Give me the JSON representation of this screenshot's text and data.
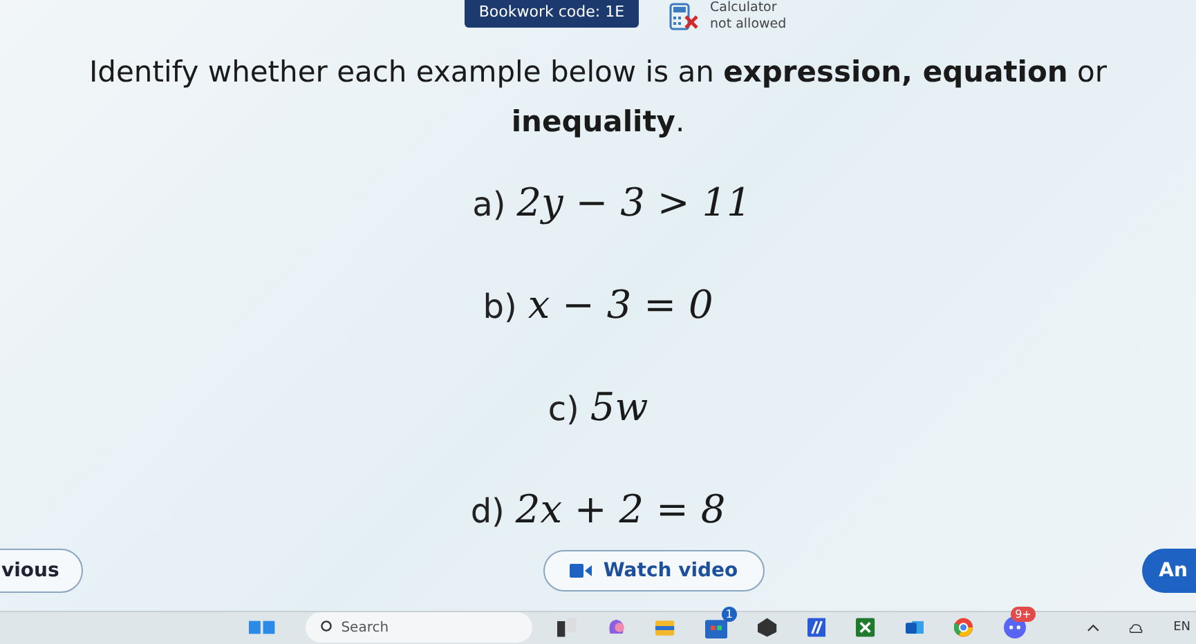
{
  "header": {
    "bookwork_code": "Bookwork code: 1E",
    "calculator_line_1": "Calculator",
    "calculator_line_2": "not allowed"
  },
  "question": "Identify whether each example below is an **expression, equation** or **inequality**.",
  "items": [
    {
      "label": "a)",
      "math": "2y − 3 > 11"
    },
    {
      "label": "b)",
      "math": "x − 3 = 0"
    },
    {
      "label": "c)",
      "math": "5w"
    },
    {
      "label": "d)",
      "math": "2x + 2 = 8"
    }
  ],
  "buttons": {
    "previous": "vious",
    "watch_video": "Watch video",
    "next": "An"
  },
  "taskbar": {
    "search_placeholder": "Search",
    "store_badge": "1",
    "discord_badge": "9+",
    "language": "EN"
  }
}
